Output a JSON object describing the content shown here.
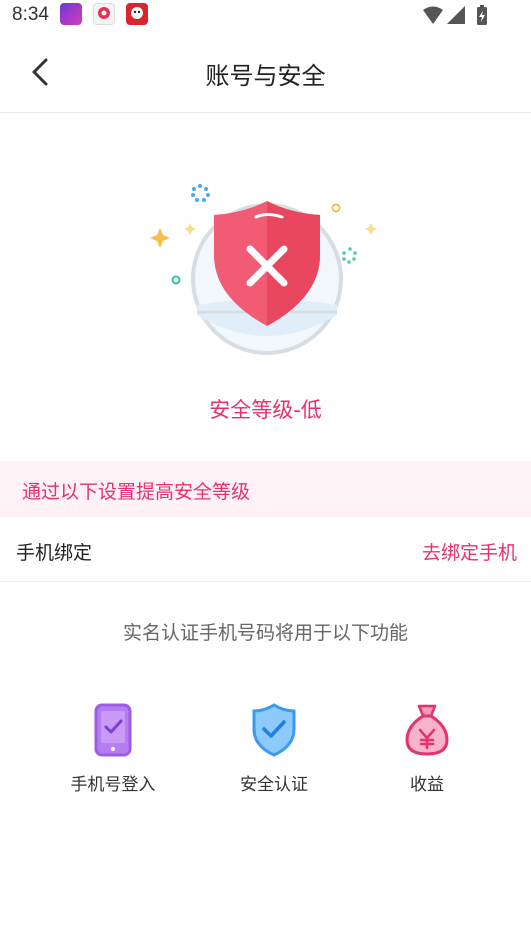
{
  "status_bar": {
    "time": "8:34",
    "icons": [
      "wifi-icon",
      "signal-icon",
      "battery-icon"
    ]
  },
  "header": {
    "back_icon": "chevron-left-icon",
    "title": "账号与安全"
  },
  "security": {
    "icon": "shield-x-icon",
    "level_text": "安全等级-低",
    "accent_color": "#e6316a"
  },
  "tip": {
    "text": "通过以下设置提高安全等级"
  },
  "phone_binding": {
    "label": "手机绑定",
    "action": "去绑定手机"
  },
  "description": "实名认证手机号码将用于以下功能",
  "features": [
    {
      "icon": "phone-check-icon",
      "label": "手机号登入"
    },
    {
      "icon": "shield-check-icon",
      "label": "安全认证"
    },
    {
      "icon": "money-bag-icon",
      "label": "收益"
    }
  ]
}
